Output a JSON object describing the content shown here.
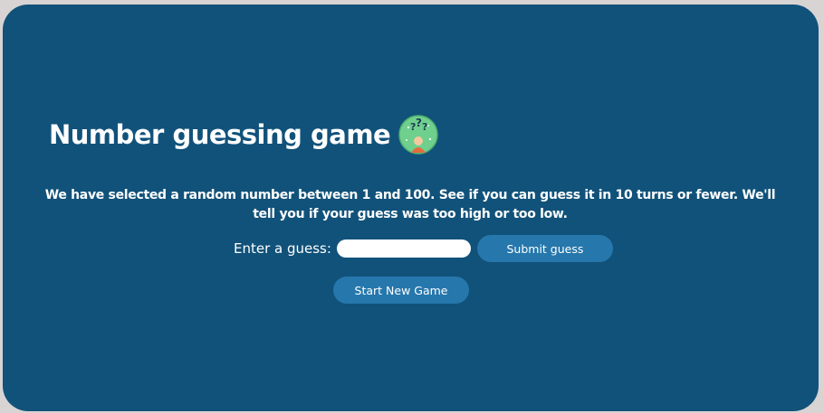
{
  "header": {
    "title": "Number guessing game",
    "icon": "thinking-face-question-marks-icon"
  },
  "intro": {
    "description": "We have selected a random number between 1 and 100. See if you can guess it in 10 turns or fewer. We'll tell you if your guess was too high or too low."
  },
  "guess_form": {
    "label": "Enter a guess:",
    "input_value": "",
    "input_placeholder": "",
    "submit_label": "Submit guess"
  },
  "controls": {
    "new_game_label": "Start New Game"
  },
  "colors": {
    "page_background": "#d8d4d4",
    "card_background": "#11527a",
    "button_background": "#2677ac",
    "text": "#ffffff"
  }
}
